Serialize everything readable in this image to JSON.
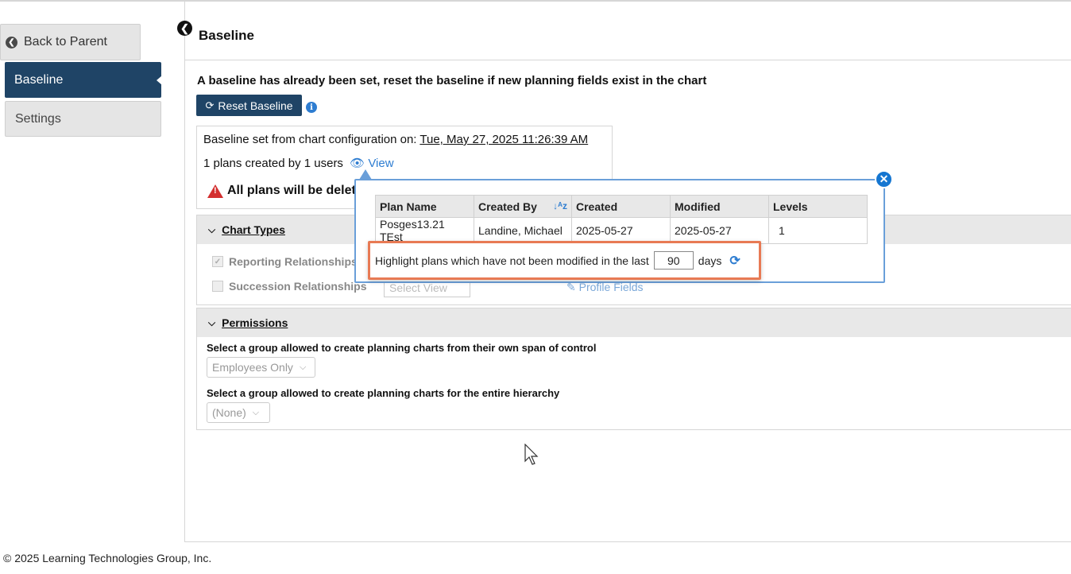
{
  "sidebar": {
    "back_label": "Back to Parent",
    "items": [
      {
        "label": "Baseline",
        "active": true
      },
      {
        "label": "Settings",
        "active": false
      }
    ]
  },
  "header": {
    "title": "Baseline"
  },
  "main": {
    "notice": "A baseline has already been set, reset the baseline if new planning fields exist in the chart",
    "reset_label": "Reset Baseline",
    "baseline_set_prefix": "Baseline set from chart configuration on: ",
    "baseline_date": "Tue, May 27, 2025 11:26:39 AM",
    "plans_created": "1 plans created by 1 users",
    "view_label": "View",
    "warning": "All plans will be delet"
  },
  "chart_types": {
    "title": "Chart Types",
    "options": [
      {
        "label": "Reporting Relationships",
        "checked": true
      },
      {
        "label": "Succession Relationships",
        "checked": false
      }
    ],
    "select_view_placeholder": "Select View",
    "profile_fields_label": "Profile Fields"
  },
  "permissions": {
    "title": "Permissions",
    "own_span_label": "Select a group allowed to create planning charts from their own span of control",
    "own_span_value": "Employees Only",
    "entire_label": "Select a group allowed to create planning charts for the entire hierarchy",
    "entire_value": "(None)"
  },
  "popover": {
    "columns": [
      "Plan Name",
      "Created By",
      "Created",
      "Modified",
      "Levels"
    ],
    "rows": [
      [
        "Posges13.21 TEst",
        "Landine, Michael",
        "2025-05-27",
        "2025-05-27",
        "1"
      ]
    ],
    "highlight_prefix": "Highlight plans which have not been modified in the last",
    "days_value": "90",
    "days_suffix": "days"
  },
  "footer": {
    "copyright": "© 2025 Learning Technologies Group, Inc."
  },
  "colors": {
    "nav_active": "#1f4466",
    "accent": "#2e7dd1",
    "highlight_border": "#e87a54",
    "danger": "#d32f2f"
  }
}
